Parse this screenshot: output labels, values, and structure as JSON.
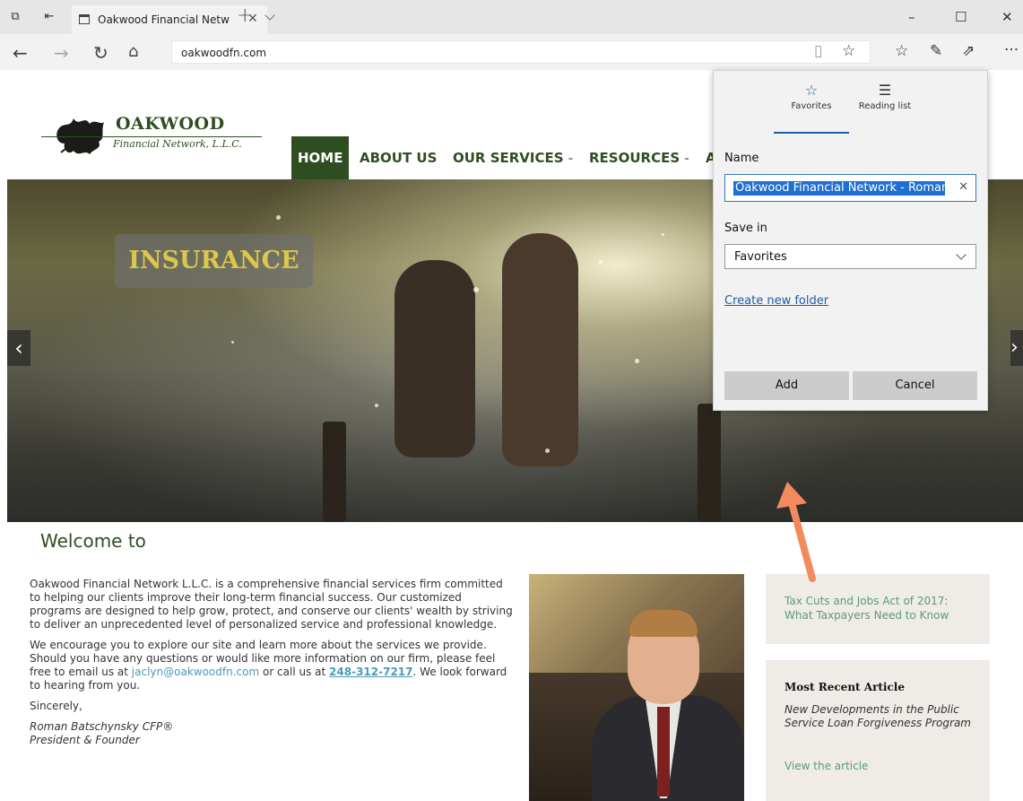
{
  "browser": {
    "tab_title": "Oakwood Financial Netw",
    "tab_close": "✕",
    "new_tab": "+",
    "url": "oakwoodfn.com",
    "window_controls": {
      "minimize": "–",
      "maximize": "☐",
      "close": "✕"
    },
    "more": "···"
  },
  "site": {
    "logo": {
      "name": "OAKWOOD",
      "subtitle": "Financial Network, L.L.C."
    },
    "nav": [
      {
        "label": "HOME"
      },
      {
        "label": "ABOUT US"
      },
      {
        "label": "OUR SERVICES",
        "caret": "-"
      },
      {
        "label": "RESOURCES",
        "caret": "-"
      },
      {
        "label": "A"
      }
    ],
    "hero": {
      "label": "INSURANCE",
      "prev": "‹",
      "next": "›"
    },
    "welcome": "Welcome to",
    "intro": {
      "p1": "Oakwood Financial Network L.L.C. is a comprehensive financial services firm committed to helping our clients improve their long-term financial success. Our customized programs are designed to help grow, protect, and conserve our clients' wealth by striving to deliver an unprecedented level of personalized service and professional knowledge.",
      "p2_before": "We encourage you to explore our site and learn more about the services we provide. Should you have any questions or would like more information on our firm, please feel free to email us at ",
      "email": "jaclyn@oakwoodfn.com",
      "p2_middle": " or call us at ",
      "phone": "248-312-7217",
      "p2_after": ". We look forward to hearing from you.",
      "closing": "Sincerely,",
      "sig_name": "Roman Batschynsky CFP®",
      "sig_title": "President & Founder"
    },
    "sidebar": {
      "tax_link": "Tax Cuts and Jobs Act of 2017: What Taxpayers Need to Know",
      "article_heading": "Most Recent Article",
      "article_title": "New Developments in the Public Service Loan Forgiveness Program",
      "article_link": "View the article"
    }
  },
  "flyout": {
    "tabs": {
      "favorites": "Favorites",
      "reading_list": "Reading list"
    },
    "name_label": "Name",
    "name_value": "Oakwood Financial Network - Roman",
    "clear": "✕",
    "save_in_label": "Save in",
    "save_in_value": "Favorites",
    "create_folder": "Create new folder",
    "add": "Add",
    "cancel": "Cancel"
  },
  "colors": {
    "brand_green": "#2e4e22",
    "link_teal": "#5d9a77",
    "accent_blue": "#1f5fa5",
    "callout_orange": "#f28a5c"
  }
}
